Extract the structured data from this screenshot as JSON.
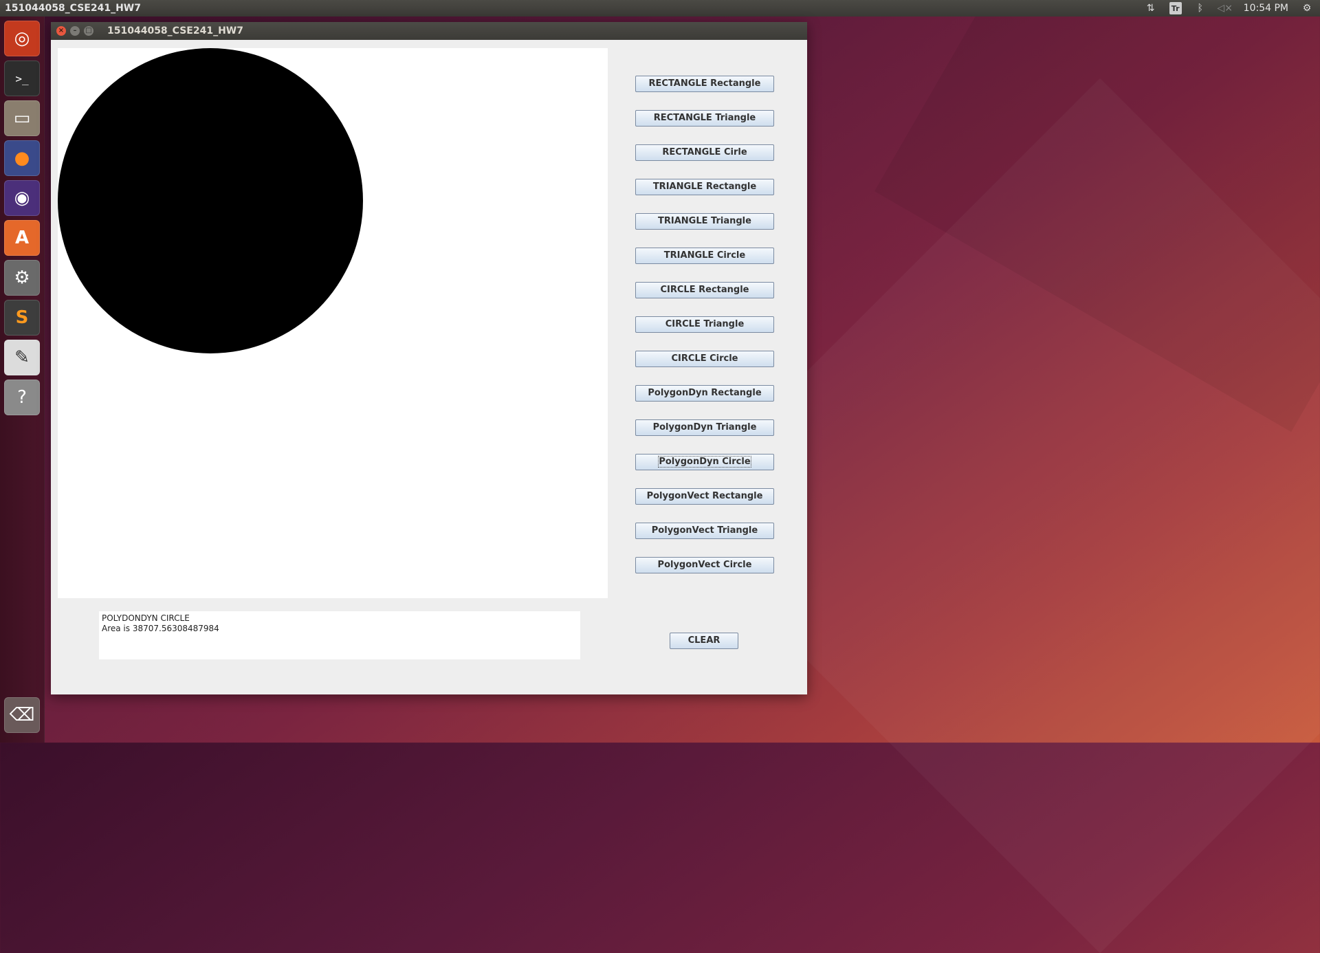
{
  "top_panel": {
    "app_title": "151044058_CSE241_HW7",
    "tray": {
      "keyboard_label": "Tr",
      "clock": "10:54 PM"
    }
  },
  "launcher": {
    "items": [
      {
        "name": "ubuntu-dash",
        "glyph": "◎"
      },
      {
        "name": "terminal",
        "glyph": ">_"
      },
      {
        "name": "files",
        "glyph": "▭"
      },
      {
        "name": "firefox",
        "glyph": "●"
      },
      {
        "name": "eclipse",
        "glyph": "◉"
      },
      {
        "name": "software-center",
        "glyph": "A"
      },
      {
        "name": "system-settings",
        "glyph": "⚙"
      },
      {
        "name": "sublime-text",
        "glyph": "S"
      },
      {
        "name": "text-editor",
        "glyph": "✎"
      },
      {
        "name": "help",
        "glyph": "?"
      },
      {
        "name": "trash",
        "glyph": "🗑"
      }
    ]
  },
  "window": {
    "title": "151044058_CSE241_HW7",
    "buttons": [
      "RECTANGLE Rectangle",
      "RECTANGLE Triangle",
      "RECTANGLE Cirle",
      "TRIANGLE Rectangle",
      "TRIANGLE Triangle",
      "TRIANGLE Circle",
      "CIRCLE Rectangle",
      "CIRCLE Triangle",
      "CIRCLE Circle",
      "PolygonDyn Rectangle",
      "PolygonDyn Triangle",
      "PolygonDyn Circle",
      "PolygonVect Rectangle",
      "PolygonVect Triangle",
      "PolygonVect Circle"
    ],
    "focused_button_index": 11,
    "output": {
      "line1": "POLYDONDYN CIRCLE",
      "line2": "Area is 38707.56308487984"
    },
    "clear_label": "CLEAR"
  },
  "colors": {
    "canvas_bg": "#ffffff",
    "shape_fill": "#000000",
    "window_bg": "#eeeeee"
  }
}
